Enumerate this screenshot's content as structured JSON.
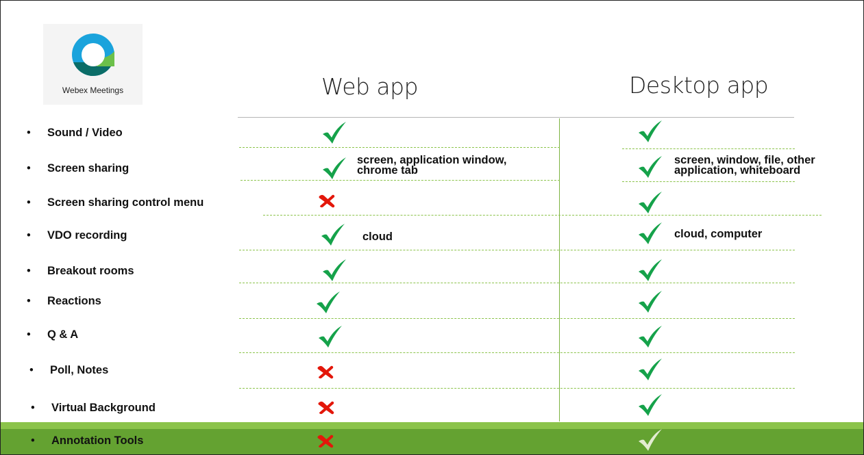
{
  "logo": {
    "caption": "Webex Meetings",
    "icon": "webex-logo-icon"
  },
  "columns": {
    "web": "Web app",
    "desktop": "Desktop app"
  },
  "bullet": "•",
  "features": [
    {
      "label": "Sound / Video",
      "web": "check",
      "desktop": "check"
    },
    {
      "label": "Screen sharing",
      "web": "check",
      "web_note": [
        "screen, application window,",
        "chrome tab"
      ],
      "desktop": "check",
      "desktop_note": [
        "screen, window, file, other",
        "application, whiteboard"
      ]
    },
    {
      "label": "Screen sharing control menu",
      "web": "cross",
      "desktop": "check"
    },
    {
      "label": "VDO recording",
      "web": "check",
      "web_note": [
        "cloud"
      ],
      "desktop": "check",
      "desktop_note": [
        "cloud, computer"
      ]
    },
    {
      "label": "Breakout rooms",
      "web": "check",
      "desktop": "check"
    },
    {
      "label": "Reactions",
      "web": "check",
      "desktop": "check"
    },
    {
      "label": "Q & A",
      "web": "check",
      "desktop": "check"
    },
    {
      "label": "Poll, Notes",
      "web": "cross",
      "desktop": "check"
    },
    {
      "label": "Virtual Background",
      "web": "cross",
      "desktop": "check"
    },
    {
      "label": "Annotation Tools",
      "web": "cross",
      "desktop": "check",
      "highlighted": true
    }
  ],
  "colors": {
    "check": "#15a24a",
    "cross": "#e3170a",
    "highlight_band": "#64a231",
    "highlight_band_top": "#8bc34a",
    "highlight_check": "#e3ecd2",
    "divider": "#8bc34a"
  }
}
